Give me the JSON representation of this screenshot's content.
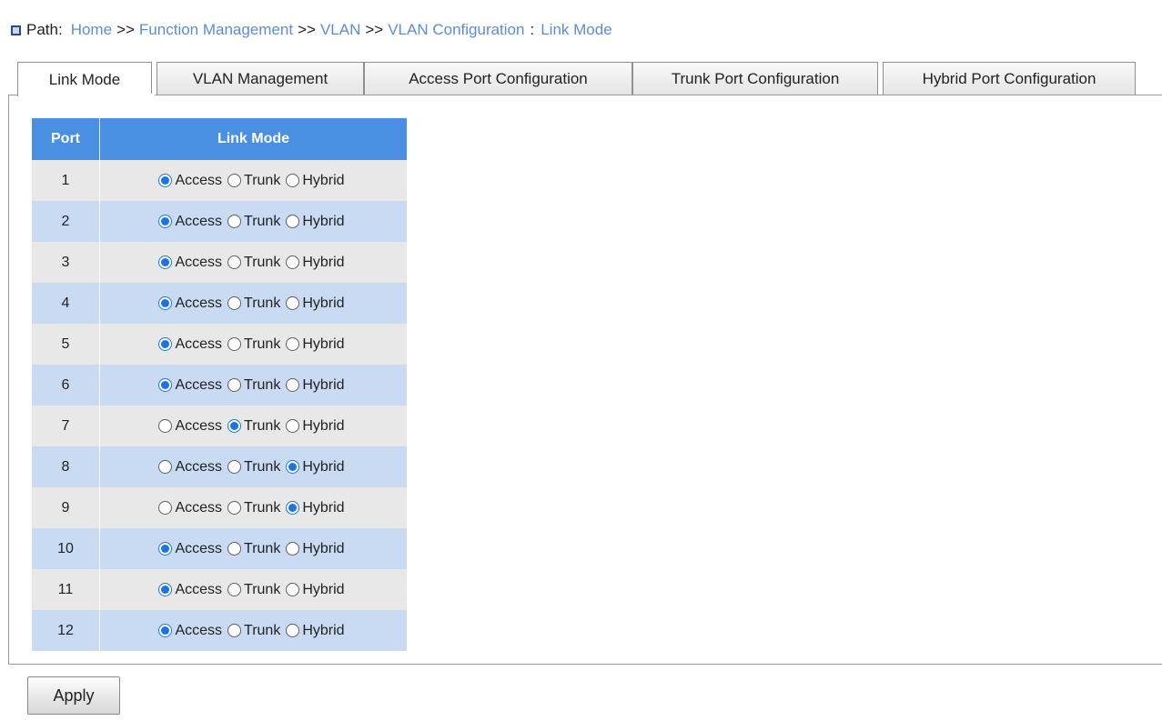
{
  "path": {
    "label": "Path:",
    "crumbs": [
      "Home",
      "Function Management",
      "VLAN",
      "VLAN Configuration",
      "Link Mode"
    ],
    "separator": ">>",
    "final_separator": ":"
  },
  "tabs": [
    {
      "label": "Link Mode",
      "active": true
    },
    {
      "label": "VLAN Management",
      "active": false
    },
    {
      "label": "Access Port Configuration",
      "active": false
    },
    {
      "label": "Trunk Port Configuration",
      "active": false
    },
    {
      "label": "Hybrid Port Configuration",
      "active": false
    }
  ],
  "table": {
    "headers": {
      "port": "Port",
      "link_mode": "Link Mode"
    },
    "options": [
      "Access",
      "Trunk",
      "Hybrid"
    ],
    "rows": [
      {
        "port": "1",
        "mode": "Access"
      },
      {
        "port": "2",
        "mode": "Access"
      },
      {
        "port": "3",
        "mode": "Access"
      },
      {
        "port": "4",
        "mode": "Access"
      },
      {
        "port": "5",
        "mode": "Access"
      },
      {
        "port": "6",
        "mode": "Access"
      },
      {
        "port": "7",
        "mode": "Trunk"
      },
      {
        "port": "8",
        "mode": "Hybrid"
      },
      {
        "port": "9",
        "mode": "Hybrid"
      },
      {
        "port": "10",
        "mode": "Access"
      },
      {
        "port": "11",
        "mode": "Access"
      },
      {
        "port": "12",
        "mode": "Access"
      }
    ]
  },
  "apply_button": "Apply",
  "colors": {
    "header_bg": "#4a90e2",
    "row_even": "#c9dbf3",
    "row_odd": "#e8e8e8",
    "link": "#5b8ed3",
    "radio_selected": "#1a73e8"
  }
}
